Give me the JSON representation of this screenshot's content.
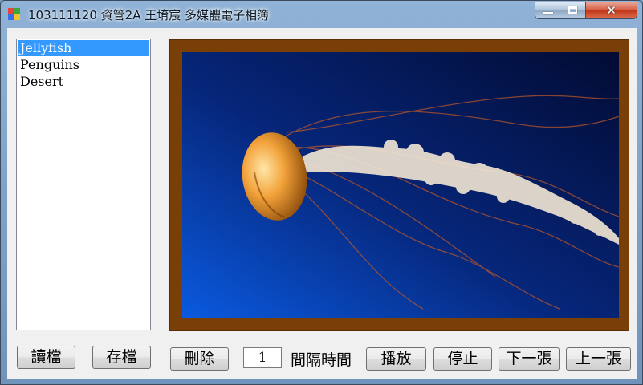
{
  "window": {
    "title": "103111120 資管2A 王堉宸 多媒體電子相簿",
    "close_glyph": "✕"
  },
  "photo_list": {
    "items": [
      "Jellyfish",
      "Penguins",
      "Desert"
    ],
    "selected_index": 0
  },
  "picture": {
    "current": "Jellyfish",
    "frame_color": "#7a3f06",
    "background_colors": [
      "#0a3f9e",
      "#02185a"
    ]
  },
  "buttons": {
    "load": "讀檔",
    "save": "存檔",
    "delete": "刪除",
    "play": "播放",
    "stop": "停止",
    "next": "下一張",
    "prev": "上一張"
  },
  "interval": {
    "value": "1",
    "label": "間隔時間"
  }
}
